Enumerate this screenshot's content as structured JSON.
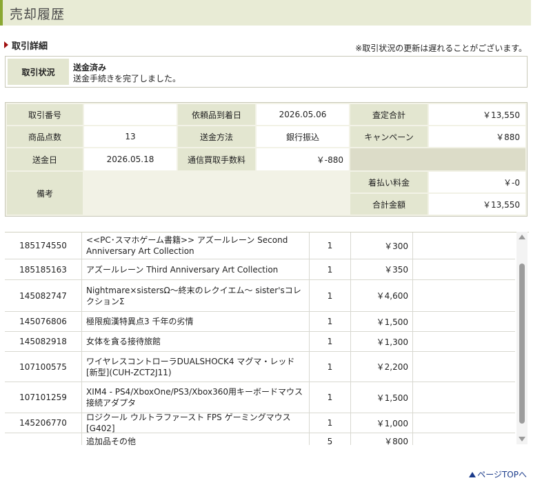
{
  "page": {
    "title": "売却履歴",
    "section_heading": "取引詳細",
    "notice": "※取引状況の更新は遅れることがございます。",
    "page_top_link": "ページTOPへ"
  },
  "status": {
    "label": "取引状況",
    "value": "送金済み",
    "description": "送金手続きを完了しました。"
  },
  "summary": {
    "labels": {
      "transaction_no": "取引番号",
      "arrival_date": "依頼品到着日",
      "appraisal_total": "査定合計",
      "item_count": "商品点数",
      "remit_method": "送金方法",
      "campaign": "キャンペーン",
      "remit_date": "送金日",
      "fee": "通信買取手数料",
      "remarks": "備考",
      "cod_fee": "着払い料金",
      "total": "合計金額"
    },
    "values": {
      "transaction_no": "",
      "arrival_date": "2026.05.06",
      "appraisal_total": "￥13,550",
      "item_count": "13",
      "remit_method": "銀行振込",
      "campaign": "￥880",
      "remit_date": "2026.05.18",
      "fee": "￥-880",
      "remarks": "",
      "cod_fee": "￥-0",
      "total": "￥13,550"
    }
  },
  "items": [
    {
      "id": "185174550",
      "name": "<<PC･スマホゲーム書籍>> アズールレーン Second Anniversary Art Collection",
      "qty": "1",
      "price": "￥300"
    },
    {
      "id": "185185163",
      "name": "アズールレーン Third Anniversary Art Collection",
      "qty": "1",
      "price": "￥350"
    },
    {
      "id": "145082747",
      "name": "Nightmare×sistersΩ～終末のレクイエム～ sister'sコレクションΣ",
      "qty": "1",
      "price": "￥4,600"
    },
    {
      "id": "145076806",
      "name": "極限痴漢特異点3 千年の劣情",
      "qty": "1",
      "price": "￥1,500"
    },
    {
      "id": "145082918",
      "name": "女体を貪る接待旅館",
      "qty": "1",
      "price": "￥1,300"
    },
    {
      "id": "107100575",
      "name": "ワイヤレスコントローラDUALSHOCK4 マグマ・レッド[新型](CUH-ZCT2J11)",
      "qty": "1",
      "price": "￥2,200"
    },
    {
      "id": "107101259",
      "name": "XIM4 - PS4/XboxOne/PS3/Xbox360用キーボードマウス接続アダプタ",
      "qty": "1",
      "price": "￥1,500"
    },
    {
      "id": "145206770",
      "name": "ロジクール ウルトラファースト FPS ゲーミングマウス[G402]",
      "qty": "1",
      "price": "￥1,000"
    },
    {
      "id": "",
      "name": "追加品その他",
      "qty": "5",
      "price": "￥800"
    }
  ]
}
